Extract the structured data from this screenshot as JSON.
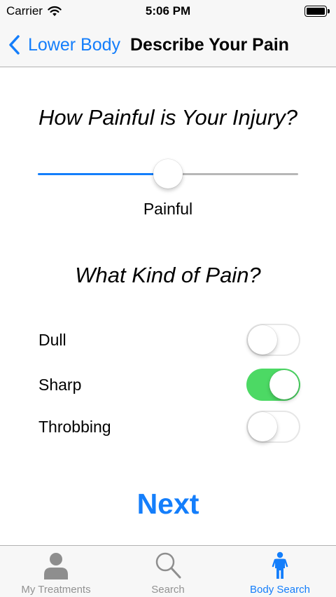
{
  "status_bar": {
    "carrier": "Carrier",
    "time": "5:06 PM"
  },
  "nav": {
    "back_label": "Lower Body",
    "title": "Describe Your Pain"
  },
  "intensity": {
    "question": "How Painful is Your Injury?",
    "slider_value_fraction": 0.5,
    "value_label": "Painful"
  },
  "pain_type": {
    "question": "What Kind of Pain?",
    "options": [
      {
        "label": "Dull",
        "on": false
      },
      {
        "label": "Sharp",
        "on": true
      },
      {
        "label": "Throbbing",
        "on": false
      }
    ]
  },
  "next_label": "Next",
  "tabs": [
    {
      "label": "My Treatments",
      "icon": "person-icon",
      "selected": false
    },
    {
      "label": "Search",
      "icon": "magnifier-icon",
      "selected": false
    },
    {
      "label": "Body Search",
      "icon": "body-icon",
      "selected": true
    }
  ],
  "colors": {
    "accent": "#147efb",
    "switch_on": "#4cd964",
    "tab_inactive": "#929292",
    "bar_background": "#f7f7f7"
  }
}
